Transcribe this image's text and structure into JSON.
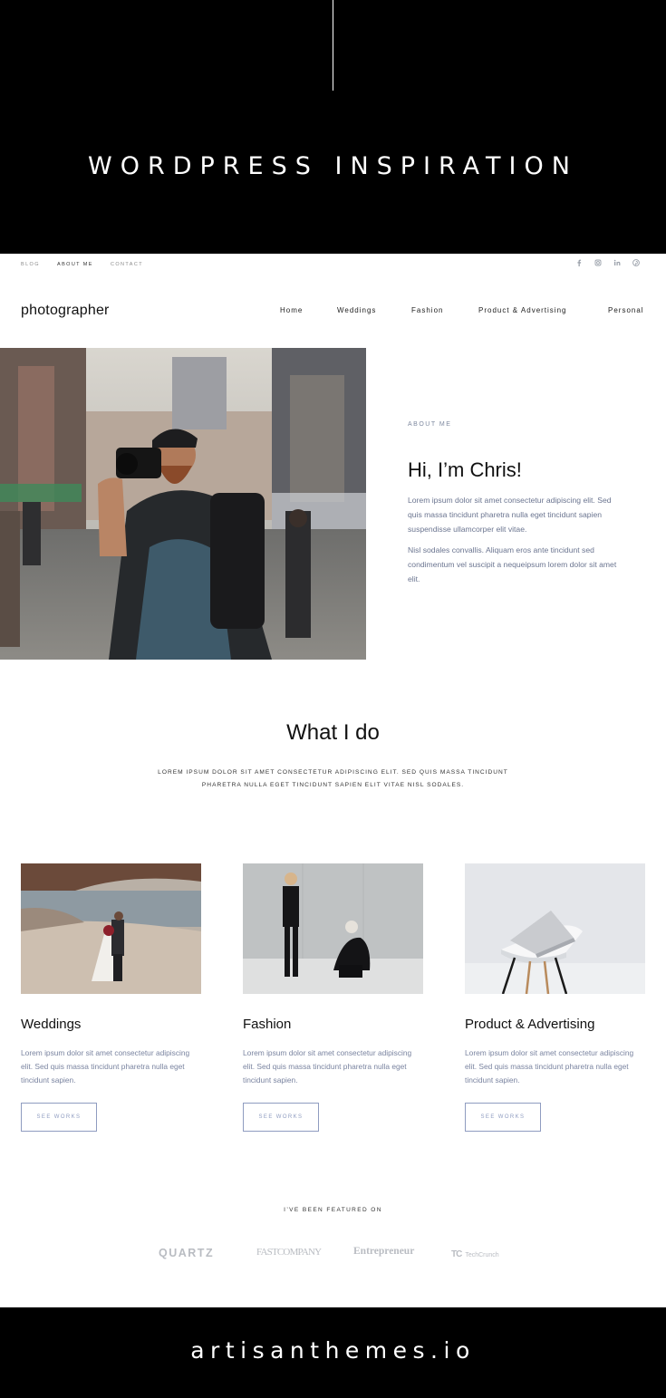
{
  "banner": {
    "title": "WORDPRESS INSPIRATION"
  },
  "utility_nav": {
    "links": [
      "BLOG",
      "ABOUT ME",
      "CONTACT"
    ],
    "social_icons": [
      "facebook-icon",
      "instagram-icon",
      "linkedin-icon",
      "pinterest-icon"
    ]
  },
  "header": {
    "logo": "photographer",
    "nav": [
      "Home",
      "Weddings",
      "Fashion",
      "Product & Advertising",
      "Personal"
    ]
  },
  "about": {
    "eyebrow": "ABOUT ME",
    "heading": "Hi, I’m Chris!",
    "paragraphs": [
      "Lorem ipsum dolor sit amet consectetur adipiscing elit. Sed quis massa tincidunt pharetra nulla eget tincidunt sapien suspendisse ullamcorper elit vitae.",
      "Nisl sodales convallis. Aliquam eros ante tincidunt sed condimentum vel suscipit a nequeipsum lorem dolor sit amet elit."
    ]
  },
  "what_i_do": {
    "title": "What I do",
    "subtitle": "LOREM IPSUM DOLOR SIT AMET CONSECTETUR ADIPISCING ELIT. SED QUIS MASSA TINCIDUNT PHARETRA NULLA EGET TINCIDUNT SAPIEN ELIT VITAE NISL SODALES."
  },
  "services": [
    {
      "title": "Weddings",
      "text": "Lorem ipsum dolor sit amet consectetur adipiscing elit. Sed quis massa tincidunt pharetra nulla eget tincidunt sapien.",
      "button": "SEE WORKS"
    },
    {
      "title": "Fashion",
      "text": "Lorem ipsum dolor sit amet consectetur adipiscing elit. Sed quis massa tincidunt pharetra nulla eget tincidunt sapien.",
      "button": "SEE WORKS"
    },
    {
      "title": "Product & Advertising",
      "text": "Lorem ipsum dolor sit amet consectetur adipiscing elit. Sed quis massa tincidunt pharetra nulla eget tincidunt sapien.",
      "button": "SEE WORKS"
    }
  ],
  "featured": {
    "label": "I’VE BEEN FEATURED ON",
    "logos": {
      "quartz": "QUARTZ",
      "fastcompany": "FASTCOMPANY",
      "entrepreneur": "Entrepreneur",
      "techcrunch_mark": "TC",
      "techcrunch": "TechCrunch"
    }
  },
  "footer": {
    "text": "artisanthemes.io"
  },
  "colors": {
    "accent": "#8f9cc0",
    "muted_text": "#6b7590",
    "banner_bg": "#000000"
  }
}
